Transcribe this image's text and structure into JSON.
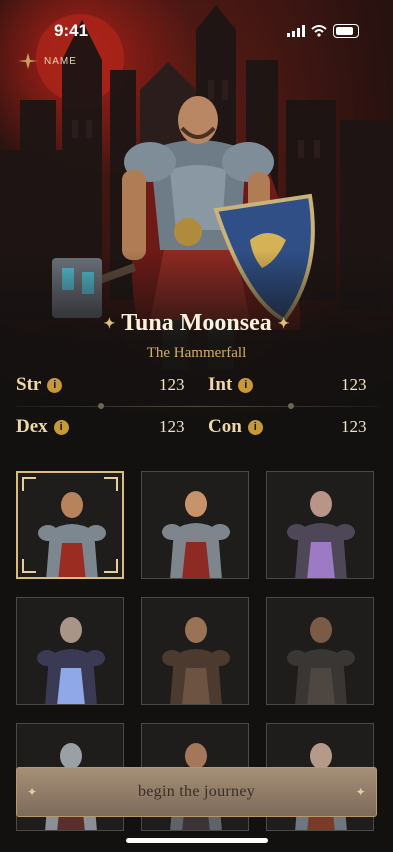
{
  "status_bar": {
    "time": "9:41"
  },
  "header": {
    "name_tag": "NAME"
  },
  "hero": {
    "name": "Tuna Moonsea",
    "subtitle": "The Hammerfall",
    "spark_glyph": "✦"
  },
  "stats": [
    {
      "label": "Str",
      "value": "123"
    },
    {
      "label": "Int",
      "value": "123"
    },
    {
      "label": "Dex",
      "value": "123"
    },
    {
      "label": "Con",
      "value": "123"
    }
  ],
  "characters": [
    {
      "id": "warrior",
      "selected": true,
      "palette": {
        "skin": "#b7835d",
        "armor": "#7d8790",
        "accent": "#9b2c22"
      }
    },
    {
      "id": "paladin-female",
      "selected": false,
      "palette": {
        "skin": "#c7936b",
        "armor": "#7e858c",
        "accent": "#8d2a24"
      }
    },
    {
      "id": "sorceress",
      "selected": false,
      "palette": {
        "skin": "#b89489",
        "armor": "#4d4757",
        "accent": "#9c7bc4"
      }
    },
    {
      "id": "wizard",
      "selected": false,
      "palette": {
        "skin": "#a99588",
        "armor": "#3b3a55",
        "accent": "#8fa8e8"
      }
    },
    {
      "id": "rogue",
      "selected": false,
      "palette": {
        "skin": "#9a7356",
        "armor": "#4d3a2e",
        "accent": "#6d5442"
      }
    },
    {
      "id": "assassin",
      "selected": false,
      "palette": {
        "skin": "#7b5b45",
        "armor": "#3a3634",
        "accent": "#4e4640"
      }
    },
    {
      "id": "knight",
      "selected": false,
      "palette": {
        "skin": "#9ba0a6",
        "armor": "#8b9097",
        "accent": "#5a2e2a"
      }
    },
    {
      "id": "brute",
      "selected": false,
      "palette": {
        "skin": "#a4775b",
        "armor": "#5f6266",
        "accent": "#3a3434"
      }
    },
    {
      "id": "old-knight",
      "selected": false,
      "palette": {
        "skin": "#b59a8a",
        "armor": "#6e7680",
        "accent": "#7a3a2a"
      }
    }
  ],
  "cta": {
    "label": "begin the journey",
    "tip_glyph": "✦"
  },
  "colors": {
    "accent_gold": "#d7ae5f",
    "background": "#121110",
    "button": "#a58f77"
  }
}
